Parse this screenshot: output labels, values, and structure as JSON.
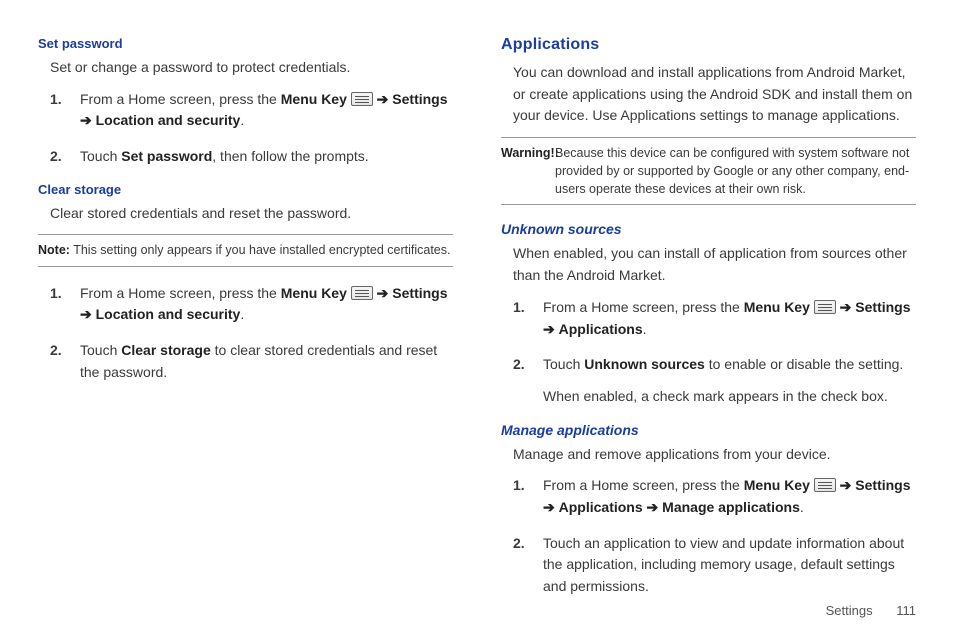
{
  "left": {
    "setPassword": {
      "heading": "Set password",
      "intro": "Set or change a password to protect credentials.",
      "step1_pre": "From a Home screen, press the ",
      "menuKey": "Menu Key",
      "arrow": "➔",
      "settings": "Settings",
      "locSec": "Location and security",
      "step2_pre": "Touch ",
      "step2_bold": "Set password",
      "step2_post": ", then follow the prompts."
    },
    "clearStorage": {
      "heading": "Clear storage",
      "intro": "Clear stored credentials and reset the password.",
      "noteLabel": "Note:",
      "noteText": " This setting only appears if you have installed encrypted certificates.",
      "step1_pre": "From a Home screen, press the ",
      "step2_pre": "Touch ",
      "step2_bold": "Clear storage",
      "step2_post": " to clear stored credentials and reset the password."
    }
  },
  "right": {
    "apps": {
      "heading": "Applications",
      "intro": "You can download and install applications from Android Market, or create applications using the Android SDK and install them on your device. Use Applications settings to manage applications.",
      "warnLabel": "Warning!:",
      "warnText": "Because this device can be configured with system software not provided by or supported by Google or any other company, end-users operate these devices at their own risk."
    },
    "unknown": {
      "heading": "Unknown sources",
      "intro": "When enabled, you can install of application from sources other than the Android Market.",
      "settings": "Settings",
      "applications": "Applications",
      "step2_pre": "Touch ",
      "step2_bold": "Unknown sources",
      "step2_post": " to enable or disable the setting.",
      "step2_line2": "When enabled, a check mark appears in the check box."
    },
    "manage": {
      "heading": "Manage applications",
      "intro": "Manage and remove applications from your device.",
      "manageApps": "Manage applications",
      "step2": "Touch an application to view and update information about the application, including memory usage, default settings and permissions."
    }
  },
  "common": {
    "num1": "1.",
    "num2": "2.",
    "period": "."
  },
  "footer": {
    "section": "Settings",
    "page": "111"
  }
}
